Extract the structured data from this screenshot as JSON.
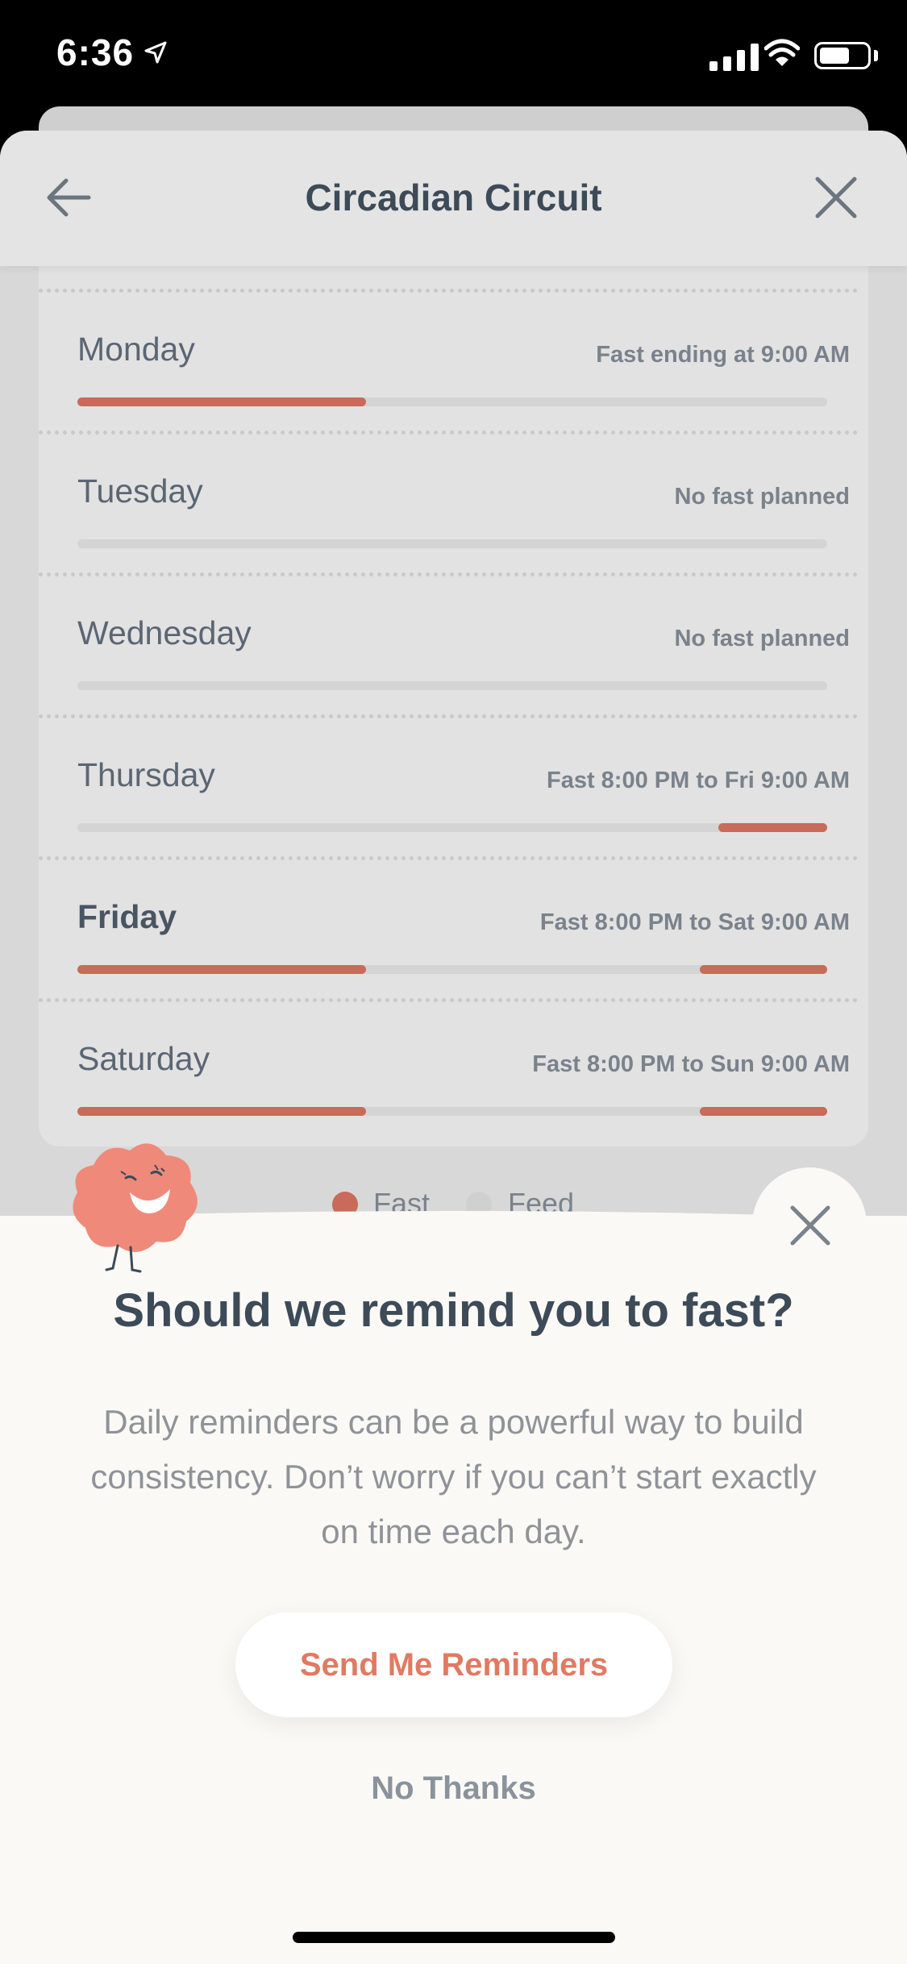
{
  "status_bar": {
    "time": "6:36"
  },
  "header": {
    "title": "Circadian Circuit"
  },
  "schedule": [
    {
      "day": "Monday",
      "status": "Fast ending at 9:00 AM",
      "bold": false,
      "fill_start": 0,
      "fill_end": 0.385
    },
    {
      "day": "Tuesday",
      "status": "No fast planned",
      "bold": false
    },
    {
      "day": "Wednesday",
      "status": "No fast planned",
      "bold": false
    },
    {
      "day": "Thursday",
      "status": "Fast 8:00 PM to Fri 9:00 AM",
      "bold": false,
      "fill_start": 0.855,
      "fill_end": 1
    },
    {
      "day": "Friday",
      "status": "Fast 8:00 PM to Sat 9:00 AM",
      "bold": true,
      "fill_start": 0,
      "fill_end": 0.385,
      "fill2_start": 0.83,
      "fill2_end": 1
    },
    {
      "day": "Saturday",
      "status": "Fast 8:00 PM to Sun 9:00 AM",
      "bold": false,
      "fill_start": 0,
      "fill_end": 0.385,
      "fill2_start": 0.83,
      "fill2_end": 1
    }
  ],
  "legend": {
    "fast": "Fast",
    "feed": "Feed"
  },
  "colors": {
    "fast": "#c96a5a",
    "feed": "#d9d9d9",
    "accent": "#e07a62"
  },
  "modal": {
    "title": "Should we remind you to fast?",
    "body": "Daily reminders can be a powerful way to build consistency. Don’t worry if you can’t start exactly on time each day.",
    "primary_label": "Send Me Reminders",
    "secondary_label": "No Thanks"
  }
}
